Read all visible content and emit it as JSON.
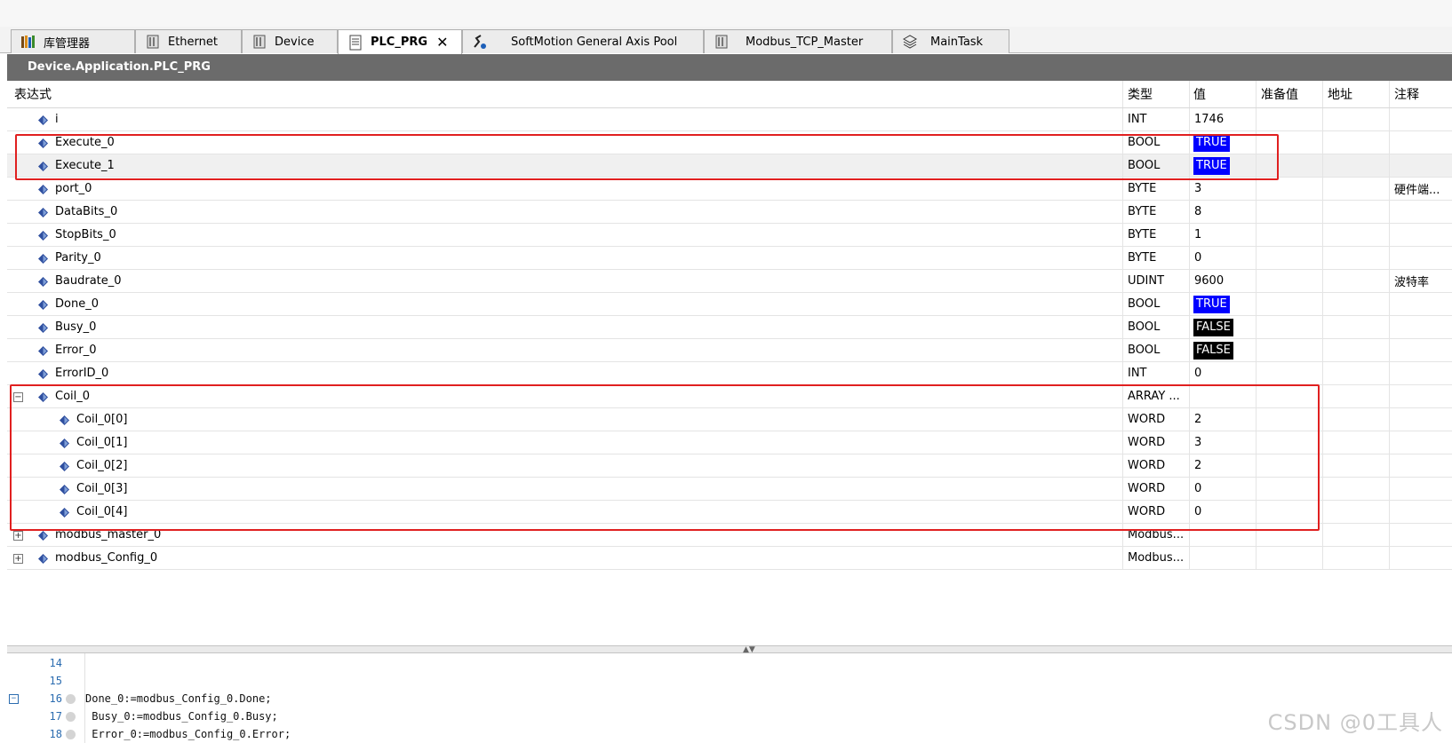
{
  "tabs": [
    {
      "label": "库管理器",
      "icon": "library-icon",
      "active": false
    },
    {
      "label": "Ethernet",
      "icon": "device-icon",
      "active": false
    },
    {
      "label": "Device",
      "icon": "device-icon",
      "active": false
    },
    {
      "label": "PLC_PRG",
      "icon": "document-icon",
      "active": true,
      "close": "✕"
    },
    {
      "label": "SoftMotion General Axis Pool",
      "icon": "axis-icon",
      "active": false
    },
    {
      "label": "Modbus_TCP_Master",
      "icon": "device-icon",
      "active": false
    },
    {
      "label": "MainTask",
      "icon": "task-icon",
      "active": false
    }
  ],
  "path": "Device.Application.PLC_PRG",
  "columns": {
    "expr": "表达式",
    "type": "类型",
    "value": "值",
    "prepared": "准备值",
    "address": "地址",
    "comment": "注释"
  },
  "rows": [
    {
      "name": "i",
      "type": "INT",
      "value": "1746",
      "comment": ""
    },
    {
      "name": "Execute_0",
      "type": "BOOL",
      "value": "TRUE",
      "comment": ""
    },
    {
      "name": "Execute_1",
      "type": "BOOL",
      "value": "TRUE",
      "comment": ""
    },
    {
      "name": "port_0",
      "type": "BYTE",
      "value": "3",
      "comment": "硬件端..."
    },
    {
      "name": "DataBits_0",
      "type": "BYTE",
      "value": "8",
      "comment": ""
    },
    {
      "name": "StopBits_0",
      "type": "BYTE",
      "value": "1",
      "comment": ""
    },
    {
      "name": "Parity_0",
      "type": "BYTE",
      "value": "0",
      "comment": ""
    },
    {
      "name": "Baudrate_0",
      "type": "UDINT",
      "value": "9600",
      "comment": "波特率"
    },
    {
      "name": "Done_0",
      "type": "BOOL",
      "value": "TRUE",
      "comment": ""
    },
    {
      "name": "Busy_0",
      "type": "BOOL",
      "value": "FALSE",
      "comment": ""
    },
    {
      "name": "Error_0",
      "type": "BOOL",
      "value": "FALSE",
      "comment": ""
    },
    {
      "name": "ErrorID_0",
      "type": "INT",
      "value": "0",
      "comment": ""
    },
    {
      "name": "Coil_0",
      "type": "ARRAY ...",
      "value": "",
      "comment": "",
      "expander": "−"
    },
    {
      "name": "Coil_0[0]",
      "type": "WORD",
      "value": "2",
      "comment": ""
    },
    {
      "name": "Coil_0[1]",
      "type": "WORD",
      "value": "3",
      "comment": ""
    },
    {
      "name": "Coil_0[2]",
      "type": "WORD",
      "value": "2",
      "comment": ""
    },
    {
      "name": "Coil_0[3]",
      "type": "WORD",
      "value": "0",
      "comment": ""
    },
    {
      "name": "Coil_0[4]",
      "type": "WORD",
      "value": "0",
      "comment": ""
    },
    {
      "name": "modbus_master_0",
      "type": "Modbus...",
      "value": "",
      "comment": "",
      "expander": "+"
    },
    {
      "name": "modbus_Config_0",
      "type": "Modbus...",
      "value": "",
      "comment": "",
      "expander": "+"
    }
  ],
  "code_lines": [
    {
      "num": "14",
      "text": ""
    },
    {
      "num": "15",
      "text": ""
    },
    {
      "num": "16",
      "text": "Done_0:=modbus_Config_0.Done;"
    },
    {
      "num": "17",
      "text": " Busy_0:=modbus_Config_0.Busy;"
    },
    {
      "num": "18",
      "text": " Error_0:=modbus_Config_0.Error;"
    }
  ],
  "fold_marker": "−",
  "watermark": "CSDN @0工具人",
  "colors": {
    "path_bar": "#6b6b6b",
    "true_bg": "#0000ff",
    "false_bg": "#000000",
    "highlight": "#e02020"
  }
}
